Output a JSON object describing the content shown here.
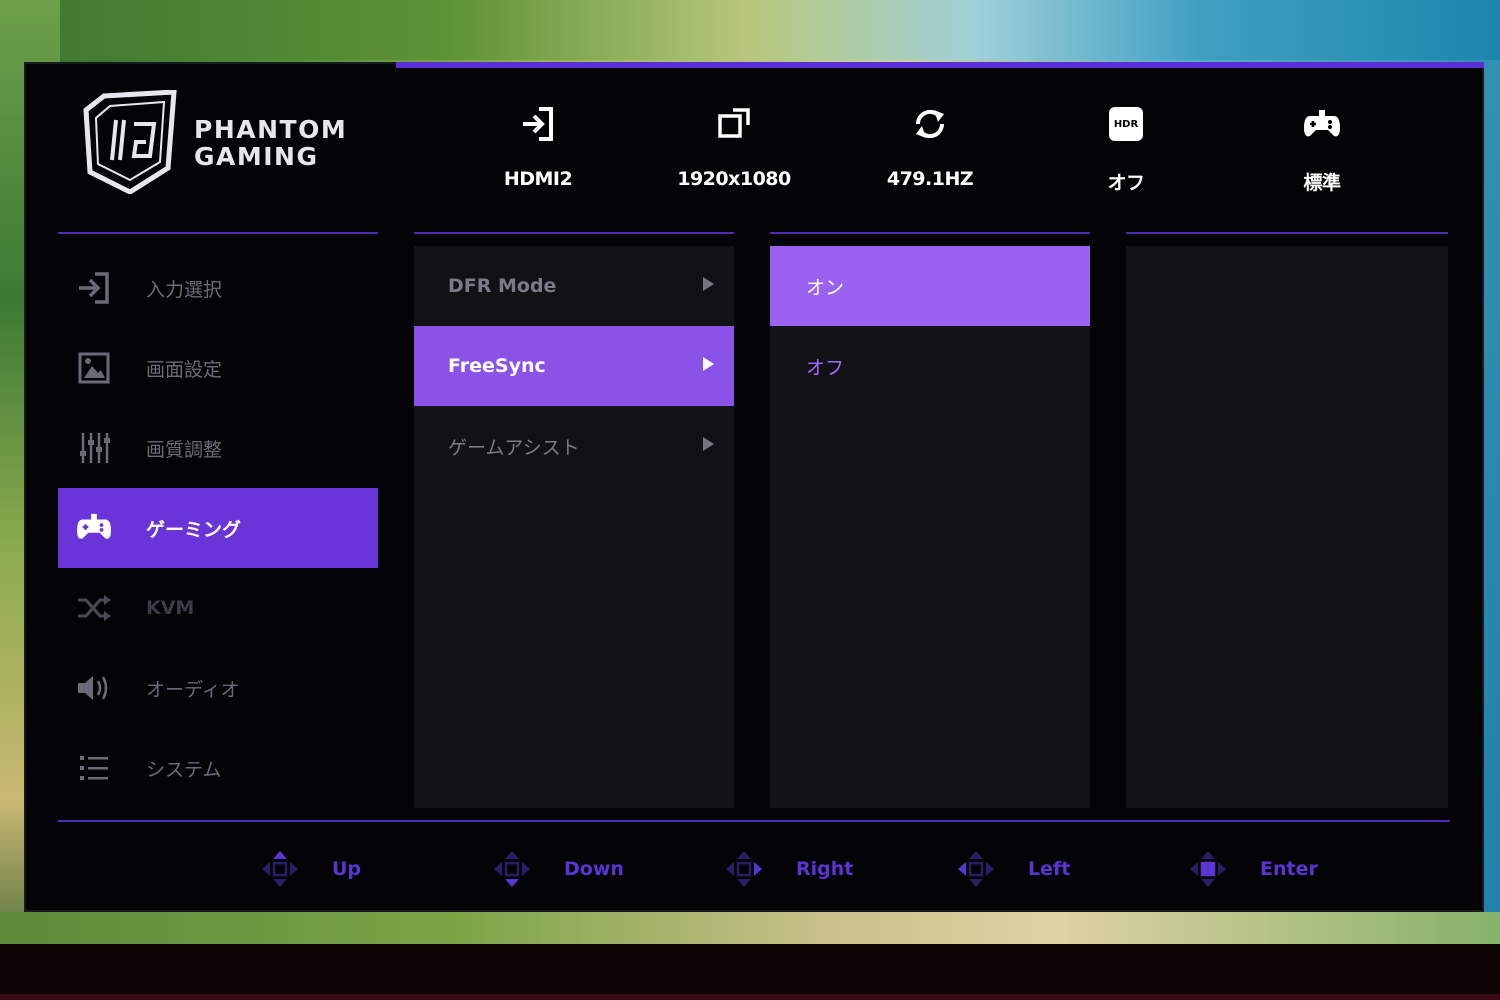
{
  "brand": {
    "line1": "PHANTOM",
    "line2": "GAMING"
  },
  "status_bar": [
    {
      "icon": "input-icon",
      "value": "HDMI2"
    },
    {
      "icon": "resolution-icon",
      "value": "1920x1080"
    },
    {
      "icon": "refresh-rate-icon",
      "value": "479.1HZ"
    },
    {
      "icon": "hdr-icon",
      "icon_text": "HDR",
      "value": "オフ"
    },
    {
      "icon": "game-mode-icon",
      "value": "標準"
    }
  ],
  "nav": [
    {
      "icon": "input-select-icon",
      "label": "入力選択",
      "state": "normal"
    },
    {
      "icon": "picture-icon",
      "label": "画面設定",
      "state": "normal"
    },
    {
      "icon": "sliders-icon",
      "label": "画質調整",
      "state": "normal"
    },
    {
      "icon": "gamepad-icon",
      "label": "ゲーミング",
      "state": "active"
    },
    {
      "icon": "kvm-icon",
      "label": "KVM",
      "state": "disabled"
    },
    {
      "icon": "audio-icon",
      "label": "オーディオ",
      "state": "normal"
    },
    {
      "icon": "system-icon",
      "label": "システム",
      "state": "normal"
    }
  ],
  "submenu": [
    {
      "label": "DFR Mode",
      "state": "normal"
    },
    {
      "label": "FreeSync",
      "state": "active"
    },
    {
      "label": "ゲームアシスト",
      "state": "normal"
    }
  ],
  "options": [
    {
      "label": "オン",
      "state": "selected"
    },
    {
      "label": "オフ",
      "state": "unselected"
    }
  ],
  "footer": [
    {
      "icon": "dpad-up-icon",
      "label": "Up"
    },
    {
      "icon": "dpad-down-icon",
      "label": "Down"
    },
    {
      "icon": "dpad-right-icon",
      "label": "Right"
    },
    {
      "icon": "dpad-left-icon",
      "label": "Left"
    },
    {
      "icon": "dpad-enter-icon",
      "label": "Enter"
    }
  ],
  "colors": {
    "accent": "#6a35d8",
    "highlight": "#8b52e8",
    "option_text": "#a06cff",
    "panel": "#040406"
  }
}
